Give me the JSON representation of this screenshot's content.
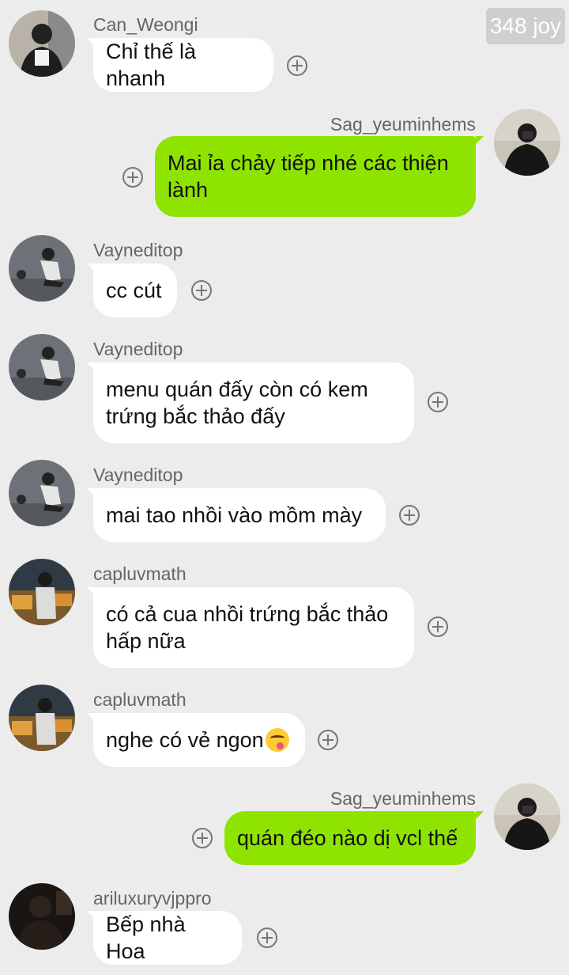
{
  "top_badge": "348 joy",
  "messages": [
    {
      "sender": "Can_Weongi",
      "text": "Chỉ thế là nhanh",
      "direction": "in"
    },
    {
      "sender": "Sag_yeuminhems",
      "text": "Mai ỉa chảy tiếp nhé các thiện\nlành",
      "direction": "out"
    },
    {
      "sender": "Vayneditop",
      "text": "cc cút",
      "direction": "in"
    },
    {
      "sender": "Vayneditop",
      "text": "menu quán đấy còn có kem\ntrứng bắc thảo đấy",
      "direction": "in"
    },
    {
      "sender": "Vayneditop",
      "text": "mai tao nhồi vào mồm mày",
      "direction": "in"
    },
    {
      "sender": "capluvmath",
      "text": " có cả cua nhồi trứng bắc thảo\nhấp nữa",
      "direction": "in"
    },
    {
      "sender": "capluvmath",
      "text": "nghe có vẻ ngon",
      "direction": "in",
      "emoji": "face-savoring-food"
    },
    {
      "sender": "Sag_yeuminhems",
      "text": "quán đéo nào dị vcl thế",
      "direction": "out"
    },
    {
      "sender": "ariluxuryvjppro",
      "text": "Bếp nhà Hoa",
      "direction": "in"
    }
  ],
  "colors": {
    "background": "#ececec",
    "incoming_bubble": "#ffffff",
    "outgoing_bubble": "#8fe300",
    "sender_name": "#666666",
    "badge": "#cfcfcf"
  }
}
